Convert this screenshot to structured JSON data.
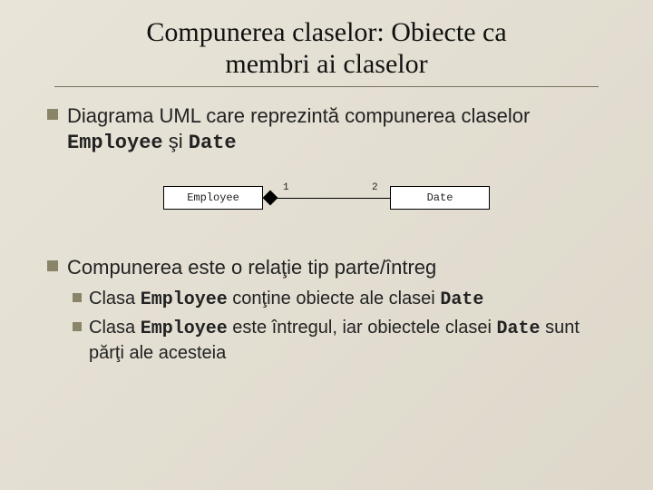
{
  "title_line1": "Compunerea claselor: Obiecte ca",
  "title_line2": "membri ai claselor",
  "b1_pre": "Diagrama UML care reprezintă compunerea claselor ",
  "b1_code1": "Employee",
  "b1_mid": " şi ",
  "b1_code2": "Date",
  "diagram": {
    "left": "Employee",
    "right": "Date",
    "mult_left": "1",
    "mult_right": "2"
  },
  "b2": "Compunerea este o relaţie tip parte/întreg",
  "b2a_pre": "Clasa ",
  "b2a_c1": "Employee",
  "b2a_mid": " conţine obiecte ale clasei ",
  "b2a_c2": "Date",
  "b2b_pre": "Clasa ",
  "b2b_c1": "Employee",
  "b2b_mid": " este întregul, iar obiectele clasei ",
  "b2b_c2": "Date",
  "b2b_post": " sunt părţi ale acesteia"
}
